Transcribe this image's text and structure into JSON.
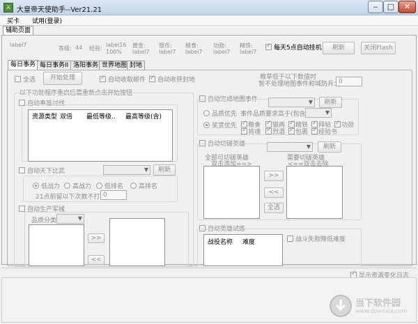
{
  "window": {
    "title": "大皇帝天使助手--Ver21.21",
    "app_icon": "sword-icon",
    "min_glyph": "‒",
    "max_glyph": "□",
    "close_glyph": "✕"
  },
  "menu": {
    "items": [
      "买卡",
      "试用(登录)"
    ]
  },
  "outer_tab": {
    "label": "辅助页面"
  },
  "status": {
    "row1": [
      {
        "label": "label7",
        "value": ""
      },
      {
        "label": "等级:",
        "value": "44"
      },
      {
        "label": "经验:",
        "value": "label16",
        "sub": "100%"
      },
      {
        "label": "黄金:",
        "value": "",
        "sub": "label7"
      },
      {
        "label": "银币:",
        "value": "",
        "sub": "label7"
      },
      {
        "label": "粮食:",
        "value": "",
        "sub": "label7"
      },
      {
        "label": "功勋:",
        "value": "",
        "sub": "label7"
      },
      {
        "label": "精铁:",
        "value": "",
        "sub": "label7"
      }
    ],
    "auto_hang_label": "每天5点自动挂机",
    "refresh_label": "刷新",
    "flash_label": "关闭Flash"
  },
  "inner_tabs": [
    "每日事务",
    "每日事务II",
    "洛阳事务",
    "世界地图",
    "封地"
  ],
  "daily": {
    "select_all": "全选",
    "start": "开始处理",
    "auto_mail": "自动收取邮件",
    "auto_fief": "自动收获封地",
    "grain_note_1": "粮草低于以下数值时",
    "grain_note_2": "暂不处理地图事件和城防兵：",
    "grain_value": "0",
    "restart_note": "以下功能程序重启后需重新点击开始按钮",
    "tribute": {
      "label": "自动奉旨讨伐",
      "columns": [
        "资源类型",
        "双倍",
        "最低等级..",
        "最高等级(含)"
      ]
    },
    "arena": {
      "label": "自动天下比武",
      "refresh": "刷新",
      "radios": [
        "低战力",
        "高战力",
        "低排名",
        "高排名"
      ],
      "retry_label": "21点前留以下次数不打：",
      "retry_value": "0"
    },
    "weapons": {
      "label": "自动生产军械",
      "category_label": "品质分类：",
      "move_right": ">>",
      "move_left": "<<"
    },
    "map": {
      "label": "自动完成地图事件",
      "refresh": "刷新",
      "quality_first": "品质优先",
      "quality_req": "事件品质要求高于(包含)",
      "reward_first": "奖赏优先",
      "rewards": [
        "粮食",
        "银两",
        "精铁",
        "拜帖",
        "功勋",
        "将魂",
        "烈酒",
        "包裹",
        "经验书"
      ]
    },
    "hero": {
      "label": "自动切磋英雄",
      "refresh": "刷新",
      "all_heroes_1": "全部可切磋英雄",
      "all_heroes_2": "双击添加==>",
      "need_heroes_1": "需要切磋英雄",
      "need_heroes_2": "<==双击去除",
      "move_right": ">>",
      "move_left": "<<",
      "select_all": "全选"
    },
    "trial": {
      "label": "自动英雄试炼",
      "columns": [
        "战役名称",
        "难度"
      ],
      "lowest_label": "战斗失败降低难度"
    }
  },
  "bottom": {
    "show_log_label": "显示资源变化日志"
  },
  "watermark": {
    "title": "当下软件园",
    "url": "www.downxia.com"
  }
}
